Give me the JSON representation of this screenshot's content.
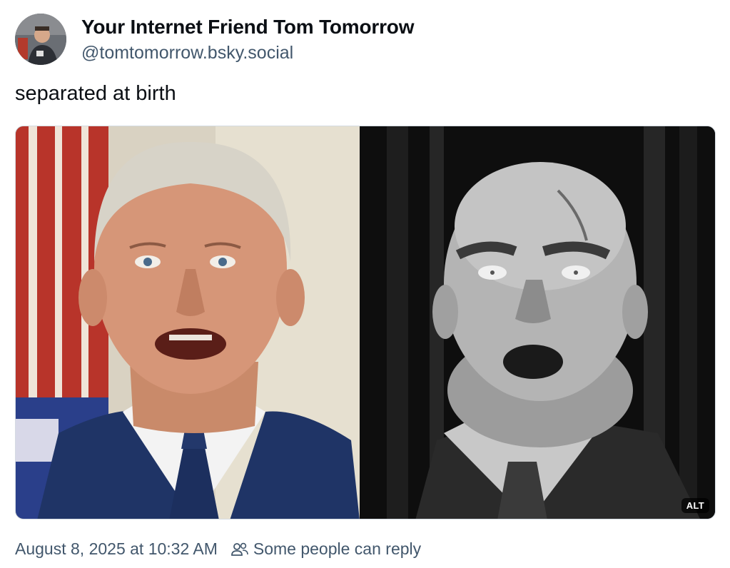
{
  "author": {
    "display_name": "Your Internet Friend Tom Tomorrow",
    "handle": "@tomtomorrow.bsky.social",
    "avatar_icon": "avatar-photo"
  },
  "post": {
    "text": "separated at birth",
    "media": {
      "alt_label": "ALT",
      "left_image": "color-photo-man-open-mouth",
      "right_image": "black-and-white-photo-man-open-mouth"
    }
  },
  "meta": {
    "timestamp": "August 8, 2025 at 10:32 AM",
    "reply_icon": "people-icon",
    "reply_setting": "Some people can reply"
  },
  "colors": {
    "text_primary": "#0b0f14",
    "text_secondary": "#42576c",
    "border": "#d4dbe2"
  }
}
